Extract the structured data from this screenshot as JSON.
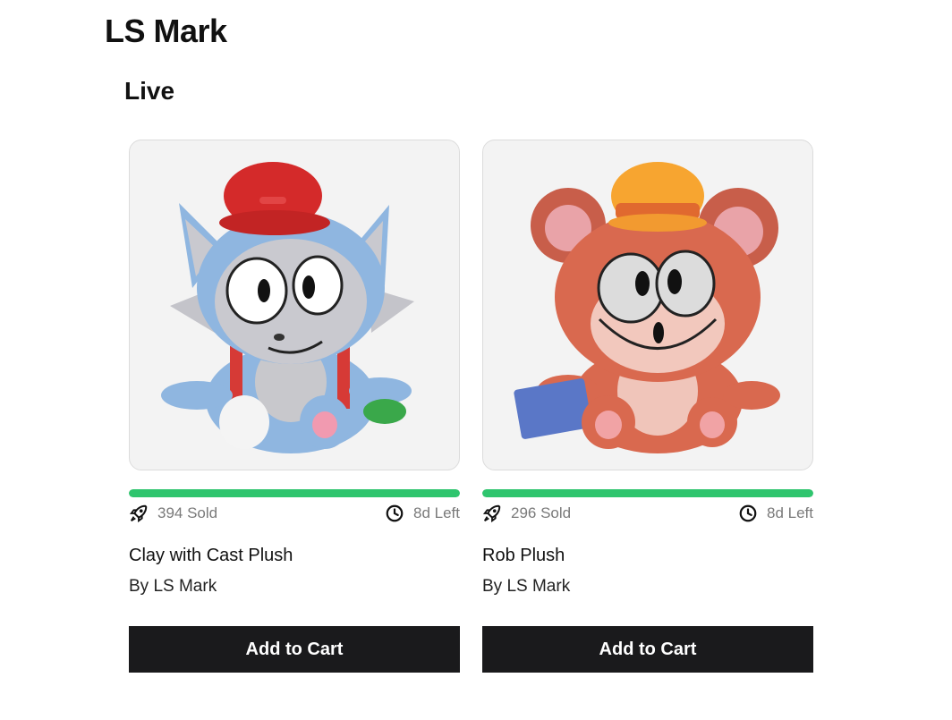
{
  "creator": {
    "title": "LS Mark"
  },
  "section": {
    "title": "Live"
  },
  "colors": {
    "progress": "#2fc56e",
    "button_bg": "#1a1a1c",
    "card_bg": "#f3f3f3"
  },
  "products": [
    {
      "name": "Clay with Cast Plush",
      "creator": "By LS Mark",
      "sold": "394 Sold",
      "time_left": "8d Left",
      "progress": 1.0,
      "image_icon": "blue-cat-plush-image",
      "button_label": "Add to Cart"
    },
    {
      "name": "Rob Plush",
      "creator": "By LS Mark",
      "sold": "296 Sold",
      "time_left": "8d Left",
      "progress": 1.0,
      "image_icon": "orange-mouse-plush-image",
      "button_label": "Add to Cart"
    }
  ]
}
